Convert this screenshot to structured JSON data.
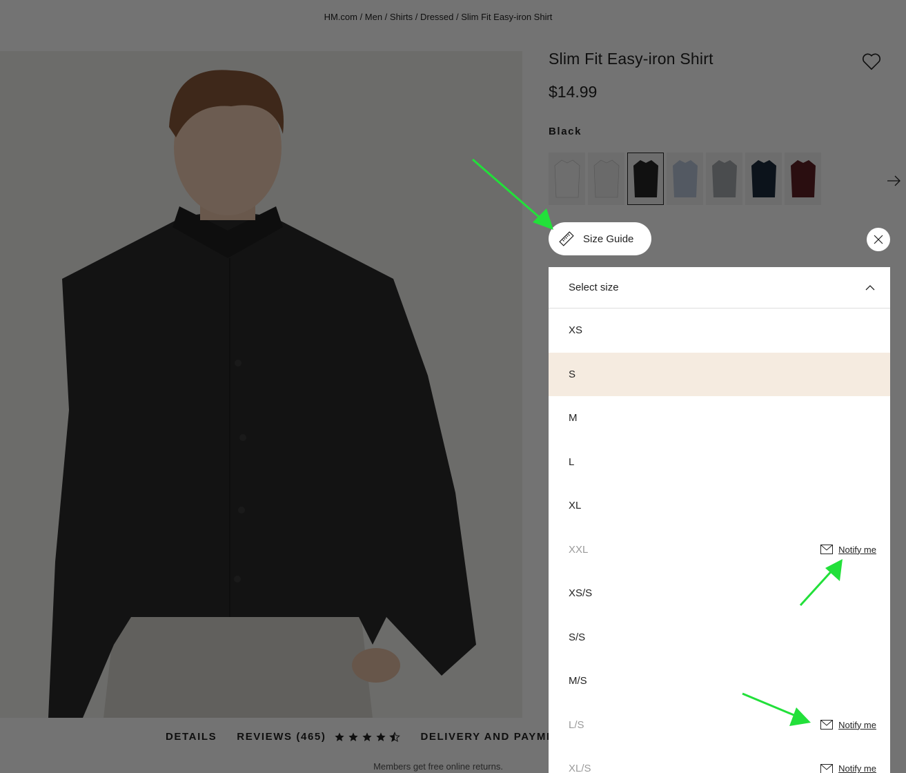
{
  "breadcrumb": "HM.com / Men / Shirts / Dressed / Slim Fit Easy-iron Shirt",
  "product": {
    "title": "Slim Fit Easy-iron Shirt",
    "price": "$14.99",
    "color_name": "Black",
    "swatches": [
      {
        "color": "#f4f4f4"
      },
      {
        "color": "#eaeaea"
      },
      {
        "color": "#262626"
      },
      {
        "color": "#b9c6d9"
      },
      {
        "color": "#a5a8ad"
      },
      {
        "color": "#1c2a3c"
      },
      {
        "color": "#5e1f24"
      }
    ]
  },
  "size_guide": {
    "label": "Size Guide",
    "icon": "ruler-icon"
  },
  "size_selector": {
    "header_label": "Select size",
    "sizes": [
      {
        "label": "XS",
        "available": true
      },
      {
        "label": "S",
        "available": true,
        "highlighted": true
      },
      {
        "label": "M",
        "available": true
      },
      {
        "label": "L",
        "available": true
      },
      {
        "label": "XL",
        "available": true
      },
      {
        "label": "XXL",
        "available": false,
        "notify": "Notify me"
      },
      {
        "label": "XS/S",
        "available": true
      },
      {
        "label": "S/S",
        "available": true
      },
      {
        "label": "M/S",
        "available": true
      },
      {
        "label": "L/S",
        "available": false,
        "notify": "Notify me"
      },
      {
        "label": "XL/S",
        "available": false,
        "notify": "Notify me"
      }
    ]
  },
  "tabs": {
    "details": "DETAILS",
    "reviews": "REVIEWS (465)",
    "rating": 4.5,
    "delivery": "DELIVERY AND PAYMENT"
  },
  "members_note": "Members get free online returns.",
  "colors": {
    "highlight": "#f5ebe0",
    "annotation_arrow": "#22e03a"
  }
}
